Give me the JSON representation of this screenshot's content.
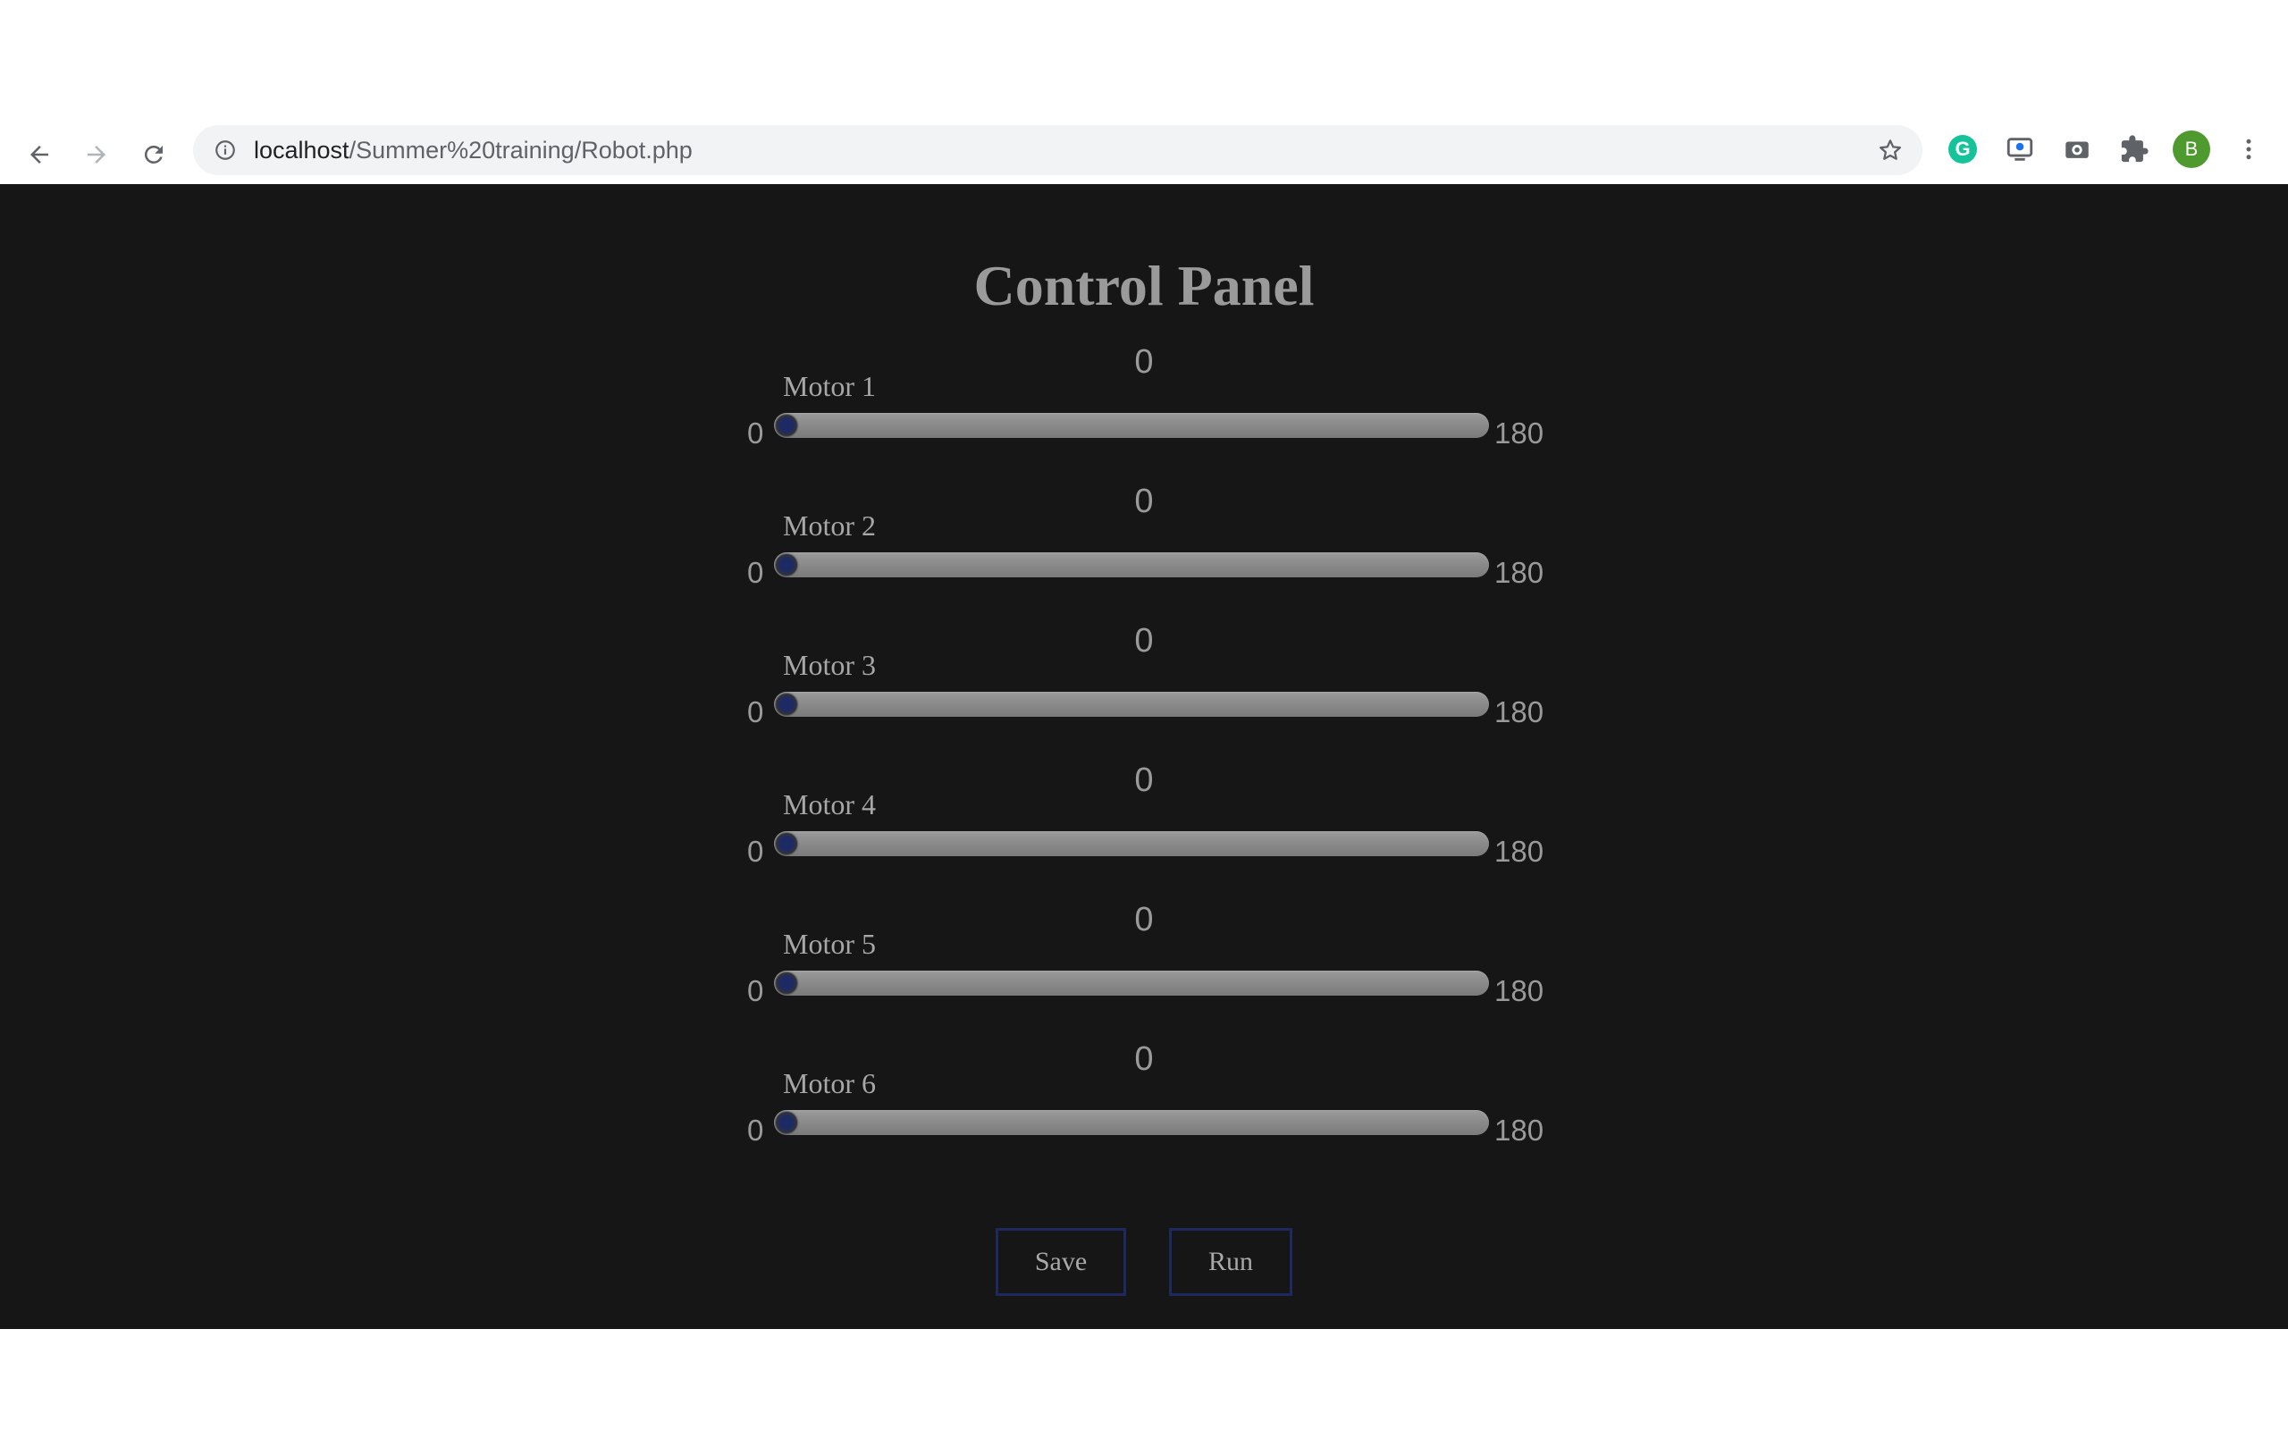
{
  "browser": {
    "url_host": "localhost",
    "url_path": "/Summer%20training/Robot.php",
    "profile_initial": "B",
    "extensions": [
      "grammarly-extension-icon",
      "screen-capture-extension-icon",
      "camera-extension-icon",
      "puzzle-icon"
    ]
  },
  "page": {
    "title": "Control Panel",
    "motors": [
      {
        "label": "Motor 1",
        "value": "0",
        "min": "0",
        "max": "180",
        "level": 0
      },
      {
        "label": "Motor 2",
        "value": "0",
        "min": "0",
        "max": "180",
        "level": 0
      },
      {
        "label": "Motor 3",
        "value": "0",
        "min": "0",
        "max": "180",
        "level": 0
      },
      {
        "label": "Motor 4",
        "value": "0",
        "min": "0",
        "max": "180",
        "level": 0
      },
      {
        "label": "Motor 5",
        "value": "0",
        "min": "0",
        "max": "180",
        "level": 0
      },
      {
        "label": "Motor 6",
        "value": "0",
        "min": "0",
        "max": "180",
        "level": 0
      }
    ],
    "save_label": "Save",
    "run_label": "Run",
    "accent_color": "#1e2a5e",
    "background_color": "#161616"
  }
}
